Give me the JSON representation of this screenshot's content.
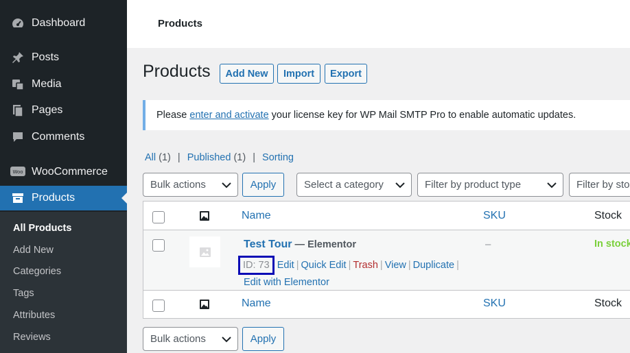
{
  "sidebar": {
    "items": [
      {
        "label": "Dashboard",
        "icon": "dashboard-icon"
      },
      {
        "label": "Posts",
        "icon": "pin-icon"
      },
      {
        "label": "Media",
        "icon": "media-icon"
      },
      {
        "label": "Pages",
        "icon": "pages-icon"
      },
      {
        "label": "Comments",
        "icon": "comment-icon"
      },
      {
        "label": "WooCommerce",
        "icon": "woo-icon"
      },
      {
        "label": "Products",
        "icon": "archive-icon"
      }
    ],
    "submenu": [
      "All Products",
      "Add New",
      "Categories",
      "Tags",
      "Attributes",
      "Reviews"
    ]
  },
  "header": {
    "title": "Products"
  },
  "page": {
    "title": "Products",
    "buttons": {
      "add_new": "Add New",
      "import": "Import",
      "export": "Export"
    }
  },
  "notice": {
    "before": "Please ",
    "link": "enter and activate",
    "after": " your license key for WP Mail SMTP Pro to enable automatic updates."
  },
  "filters": {
    "all": "All",
    "all_count": "(1)",
    "published": "Published",
    "published_count": "(1)",
    "sorting": "Sorting",
    "sep": "|"
  },
  "controls": {
    "bulk_actions": "Bulk actions",
    "apply": "Apply",
    "category": "Select a category",
    "product_type": "Filter by product type",
    "stock": "Filter by stock status"
  },
  "table": {
    "columns": {
      "name": "Name",
      "sku": "SKU",
      "stock": "Stock"
    },
    "rows": [
      {
        "name": "Test Tour",
        "suffix": " — Elementor",
        "id": "ID: 73",
        "actions": {
          "edit": "Edit",
          "quick_edit": "Quick Edit",
          "trash": "Trash",
          "view": "View",
          "duplicate": "Duplicate",
          "elementor": "Edit with Elementor"
        },
        "sku": "–",
        "stock": "In stock"
      }
    ]
  },
  "colors": {
    "sidebar_bg": "#1d2327",
    "accent": "#2271b1",
    "in_stock": "#7ad03a",
    "trash": "#b32d2e"
  }
}
